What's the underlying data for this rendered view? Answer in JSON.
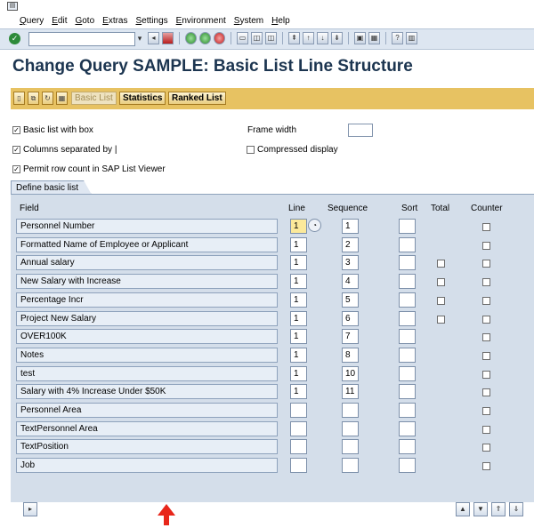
{
  "menu": [
    "Query",
    "Edit",
    "Goto",
    "Extras",
    "Settings",
    "Environment",
    "System",
    "Help"
  ],
  "toolbar": {
    "command_value": "",
    "icons": [
      "check-icon",
      "save-icon",
      "back-icon",
      "exit-icon",
      "cancel-icon",
      "print-icon",
      "find-icon",
      "find-next-icon",
      "first-page-icon",
      "previous-page-icon",
      "next-page-icon",
      "last-page-icon",
      "create-session-icon",
      "shortcut-icon",
      "help-icon",
      "layout-icon"
    ]
  },
  "page": {
    "title": "Change Query SAMPLE: Basic List Line Structure"
  },
  "app_toolbar": {
    "buttons": [
      "Basic List",
      "Statistics",
      "Ranked List"
    ]
  },
  "options": {
    "basic_list_with_box": {
      "label": "Basic list with box",
      "checked": true
    },
    "columns_separated": {
      "label": "Columns separated by |",
      "checked": true
    },
    "permit_row_count": {
      "label": "Permit row count in SAP List Viewer",
      "checked": true
    },
    "frame_width": {
      "label": "Frame width",
      "value": ""
    },
    "compressed_display": {
      "label": "Compressed display",
      "checked": false
    }
  },
  "tab": {
    "label": "Define basic list"
  },
  "columns": {
    "field": "Field",
    "line": "Line",
    "sequence": "Sequence",
    "sort": "Sort",
    "total": "Total",
    "counter": "Counter"
  },
  "rows": [
    {
      "field": "Personnel Number",
      "line": "1",
      "seq": "1",
      "total": false
    },
    {
      "field": "Formatted Name of Employee or Applicant",
      "line": "1",
      "seq": "2",
      "total": false
    },
    {
      "field": "Annual salary",
      "line": "1",
      "seq": "3",
      "total": true
    },
    {
      "field": "New Salary with Increase",
      "line": "1",
      "seq": "4",
      "total": true
    },
    {
      "field": "Percentage Incr",
      "line": "1",
      "seq": "5",
      "total": true
    },
    {
      "field": "Project New Salary",
      "line": "1",
      "seq": "6",
      "total": true
    },
    {
      "field": "OVER100K",
      "line": "1",
      "seq": "7",
      "total": false
    },
    {
      "field": "Notes",
      "line": "1",
      "seq": "8",
      "total": false
    },
    {
      "field": "test",
      "line": "1",
      "seq": "10",
      "total": false
    },
    {
      "field": "Salary with 4% Increase Under $50K",
      "line": "1",
      "seq": "11",
      "total": false
    },
    {
      "field": "Personnel Area",
      "line": "",
      "seq": "",
      "total": false
    },
    {
      "field": "TextPersonnel Area",
      "line": "",
      "seq": "",
      "total": false
    },
    {
      "field": "TextPosition",
      "line": "",
      "seq": "",
      "total": false
    },
    {
      "field": "Job",
      "line": "",
      "seq": "",
      "total": false
    }
  ],
  "colors": {
    "annotation_arrow": "#e8261a",
    "app_toolbar": "#e7c262",
    "title": "#1c3550"
  }
}
